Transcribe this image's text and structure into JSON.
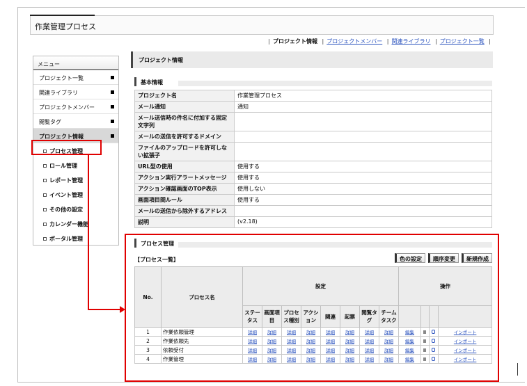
{
  "window": {
    "title": "作業管理プロセス"
  },
  "top_links": [
    {
      "label": "プロジェクト情報",
      "current": true
    },
    {
      "label": "プロジェクトメンバー",
      "current": false
    },
    {
      "label": "関連ライブラリ",
      "current": false
    },
    {
      "label": "プロジェクト一覧",
      "current": false
    }
  ],
  "sidebar": {
    "header": "メニュー",
    "items": [
      {
        "label": "プロジェクト一覧"
      },
      {
        "label": "関連ライブラリ"
      },
      {
        "label": "プロジェクトメンバー"
      },
      {
        "label": "閲覧タグ"
      },
      {
        "label": "プロジェクト情報",
        "active": true
      }
    ],
    "subitems": [
      {
        "label": "プロセス管理"
      },
      {
        "label": "ロール管理"
      },
      {
        "label": "レポート管理"
      },
      {
        "label": "イベント管理"
      },
      {
        "label": "その他の設定"
      },
      {
        "label": "カレンダー機能"
      },
      {
        "label": "ポータル管理"
      }
    ]
  },
  "main": {
    "title": "プロジェクト情報",
    "basic_section": "基本情報",
    "info_rows": [
      {
        "key": "プロジェクト名",
        "value": "作業管理プロセス"
      },
      {
        "key": "メール通知",
        "value": "通知"
      },
      {
        "key": "メール送信時の件名に付加する固定文字列",
        "value": ""
      },
      {
        "key": "メールの送信を許可するドメイン",
        "value": ""
      },
      {
        "key": "ファイルのアップロードを許可しない拡張子",
        "value": ""
      },
      {
        "key": "URL型の使用",
        "value": "使用する"
      },
      {
        "key": "アクション実行アラートメッセージ",
        "value": "使用する"
      },
      {
        "key": "アクション確認画面のTOP表示",
        "value": "使用しない"
      },
      {
        "key": "画面項目間ルール",
        "value": "使用する"
      },
      {
        "key": "メールの送信から除外するアドレス",
        "value": ""
      },
      {
        "key": "説明",
        "value": "(v2.18)"
      }
    ],
    "process_section": "プロセス管理",
    "list_title": "【プロセス一覧】",
    "buttons": {
      "color": "色の設定",
      "order": "順序変更",
      "new": "新規作成"
    },
    "table": {
      "h_no": "No.",
      "h_name": "プロセス名",
      "h_settings": "設定",
      "h_ops": "操作",
      "sub_headers": [
        "ステータス",
        "画面項目",
        "プロセス種別",
        "アクション",
        "関連",
        "起票",
        "閲覧タグ",
        "チームタスク"
      ],
      "link_label": "詳細",
      "edit_label": "編集",
      "import_label": "インポート",
      "rows": [
        {
          "no": "1",
          "name": "作業依頼管理"
        },
        {
          "no": "2",
          "name": "作業依頼先"
        },
        {
          "no": "3",
          "name": "依頼受付"
        },
        {
          "no": "4",
          "name": "作業管理"
        }
      ]
    }
  }
}
